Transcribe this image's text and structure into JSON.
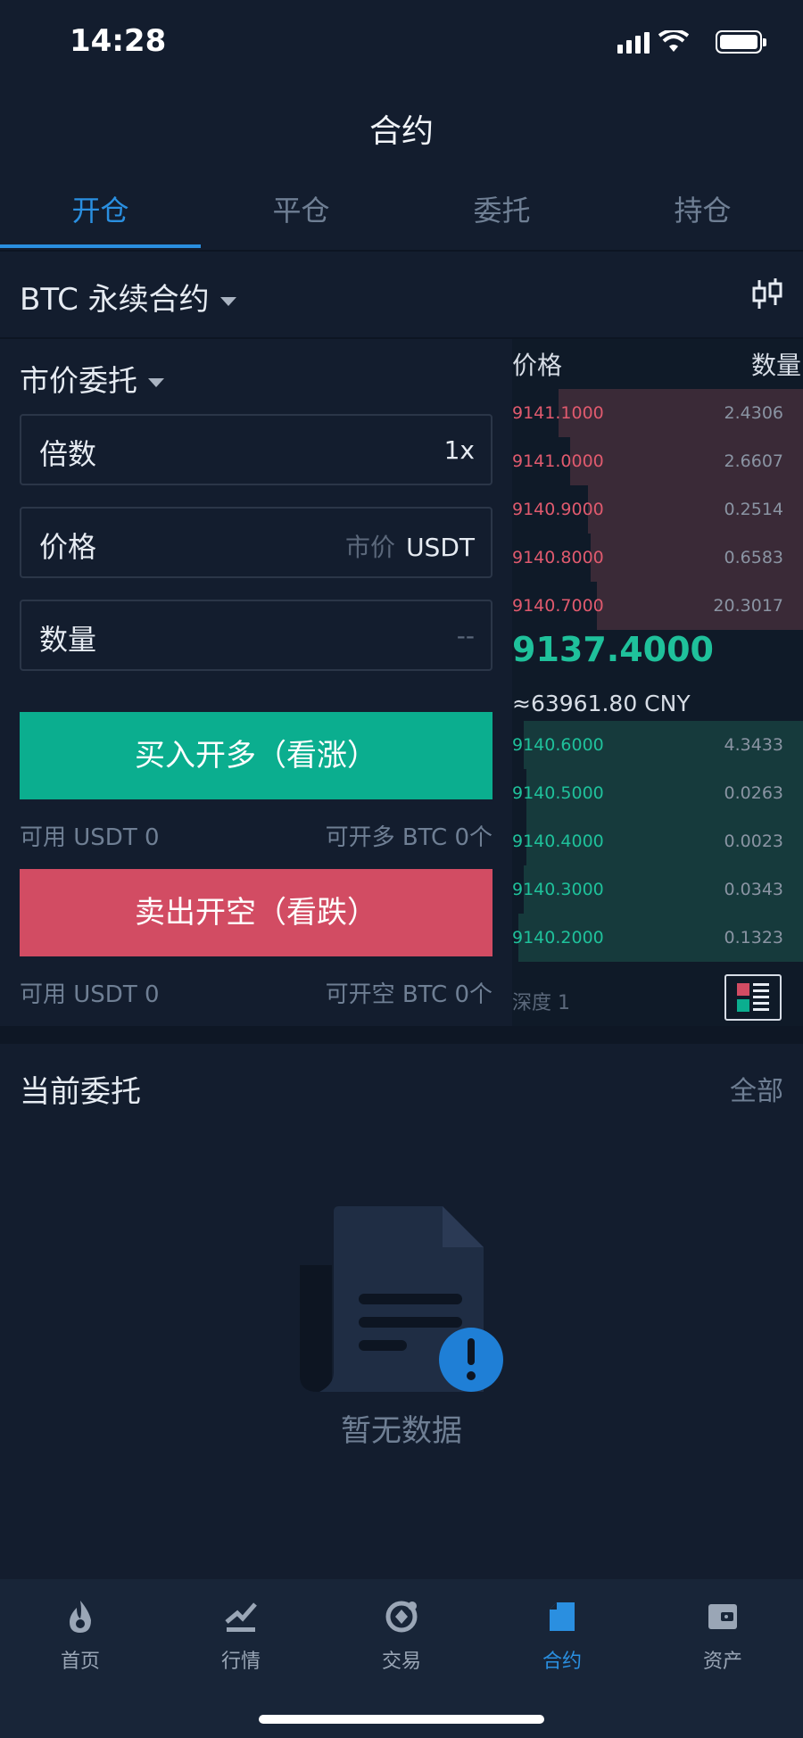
{
  "status": {
    "time": "14:28"
  },
  "header": {
    "title": "合约"
  },
  "tabs": [
    {
      "label": "开仓",
      "active": true
    },
    {
      "label": "平仓",
      "active": false
    },
    {
      "label": "委托",
      "active": false
    },
    {
      "label": "持仓",
      "active": false
    }
  ],
  "contract": {
    "name": "BTC 永续合约"
  },
  "order": {
    "type": "市价委托",
    "leverage": {
      "label": "倍数",
      "value": "1x"
    },
    "price": {
      "label": "价格",
      "placeholder": "市价",
      "unit": "USDT"
    },
    "quantity": {
      "label": "数量",
      "placeholder": "--"
    },
    "buy_button": "买入开多（看涨）",
    "sell_button": "卖出开空（看跌）",
    "buy_available": "可用 USDT 0",
    "buy_openable": "可开多 BTC 0个",
    "sell_available": "可用 USDT 0",
    "sell_openable": "可开空 BTC 0个"
  },
  "orderbook": {
    "price_header": "价格",
    "qty_header": "数量",
    "asks": [
      {
        "price": "9141.1000",
        "qty": "2.4306",
        "depth": 0.84
      },
      {
        "price": "9141.0000",
        "qty": "2.6607",
        "depth": 0.8
      },
      {
        "price": "9140.9000",
        "qty": "0.2514",
        "depth": 0.74
      },
      {
        "price": "9140.8000",
        "qty": "0.6583",
        "depth": 0.73
      },
      {
        "price": "9140.7000",
        "qty": "20.3017",
        "depth": 0.71
      }
    ],
    "last_price": "9137.4000",
    "cny": "≈63961.80 CNY",
    "bids": [
      {
        "price": "9140.6000",
        "qty": "4.3433",
        "depth": 0.96
      },
      {
        "price": "9140.5000",
        "qty": "0.0263",
        "depth": 0.95
      },
      {
        "price": "9140.4000",
        "qty": "0.0023",
        "depth": 0.95
      },
      {
        "price": "9140.3000",
        "qty": "0.0343",
        "depth": 0.96
      },
      {
        "price": "9140.2000",
        "qty": "0.1323",
        "depth": 0.98
      }
    ],
    "depth_label": "深度 1"
  },
  "current_orders": {
    "title": "当前委托",
    "all_link": "全部",
    "empty_text": "暂无数据"
  },
  "nav": [
    {
      "label": "首页",
      "icon": "flame-icon",
      "active": false
    },
    {
      "label": "行情",
      "icon": "chart-icon",
      "active": false
    },
    {
      "label": "交易",
      "icon": "exchange-icon",
      "active": false
    },
    {
      "label": "合约",
      "icon": "contract-icon",
      "active": true
    },
    {
      "label": "资产",
      "icon": "wallet-icon",
      "active": false
    }
  ],
  "colors": {
    "accent": "#2a8fe0",
    "buy": "#0bae8f",
    "sell": "#d24c63",
    "background": "#131d2e"
  }
}
